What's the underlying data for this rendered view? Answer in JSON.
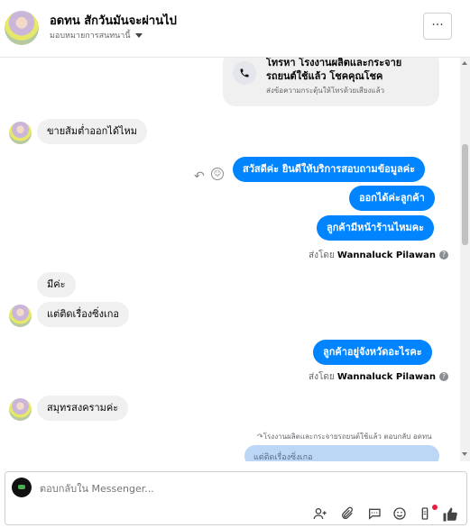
{
  "header": {
    "contact_name": "อดทน สักวันมันจะผ่านไป",
    "assign_label": "มอบหมายการสนทนานี้",
    "more_label": "···"
  },
  "call_card": {
    "title": "โทรหา โรงงานผลิตและกระจาย รถยนต์ใช้แล้ว โชคคุณโชค",
    "subtitle": "ส่งข้อความกระตุ้นให้โทรด้วยเสียงแล้ว"
  },
  "messages": {
    "in_1": "ขายส้มต่ำออกได้ไหม",
    "out_1": "สวัสดีค่ะ  ยินดีให้บริการสอบถามข้อมูลค่ะ",
    "out_2": "ออกได้ค่ะลูกค้า",
    "out_3": "ลูกค้ามีหน้าร้านไหมคะ",
    "in_2": "มีค่ะ",
    "in_3": "แต่ติดเรื่องซิ่งเกอ",
    "out_4": "ลูกค้าอยู่จังหวัดอะไรคะ",
    "in_4": "สมุทรสงครามค่ะ"
  },
  "sent_by": {
    "prefix": "ส่งโดย",
    "name": "Wannaluck Pilawan"
  },
  "reply": {
    "label": "โรงงานผลิตและกระจายรถยนต์ใช้แล้ว ตอบกลับ อดทน",
    "quoted_text": "แต่ติดเรื่องซิ่งเกอ"
  },
  "composer": {
    "placeholder": "ตอบกลับใน Messenger..."
  },
  "icons": [
    "phone-icon",
    "reply-icon",
    "emoji-icon",
    "info-icon",
    "add-person-icon",
    "attach-icon",
    "saved-reply-icon",
    "emoji-icon",
    "tag-icon",
    "like-icon"
  ]
}
